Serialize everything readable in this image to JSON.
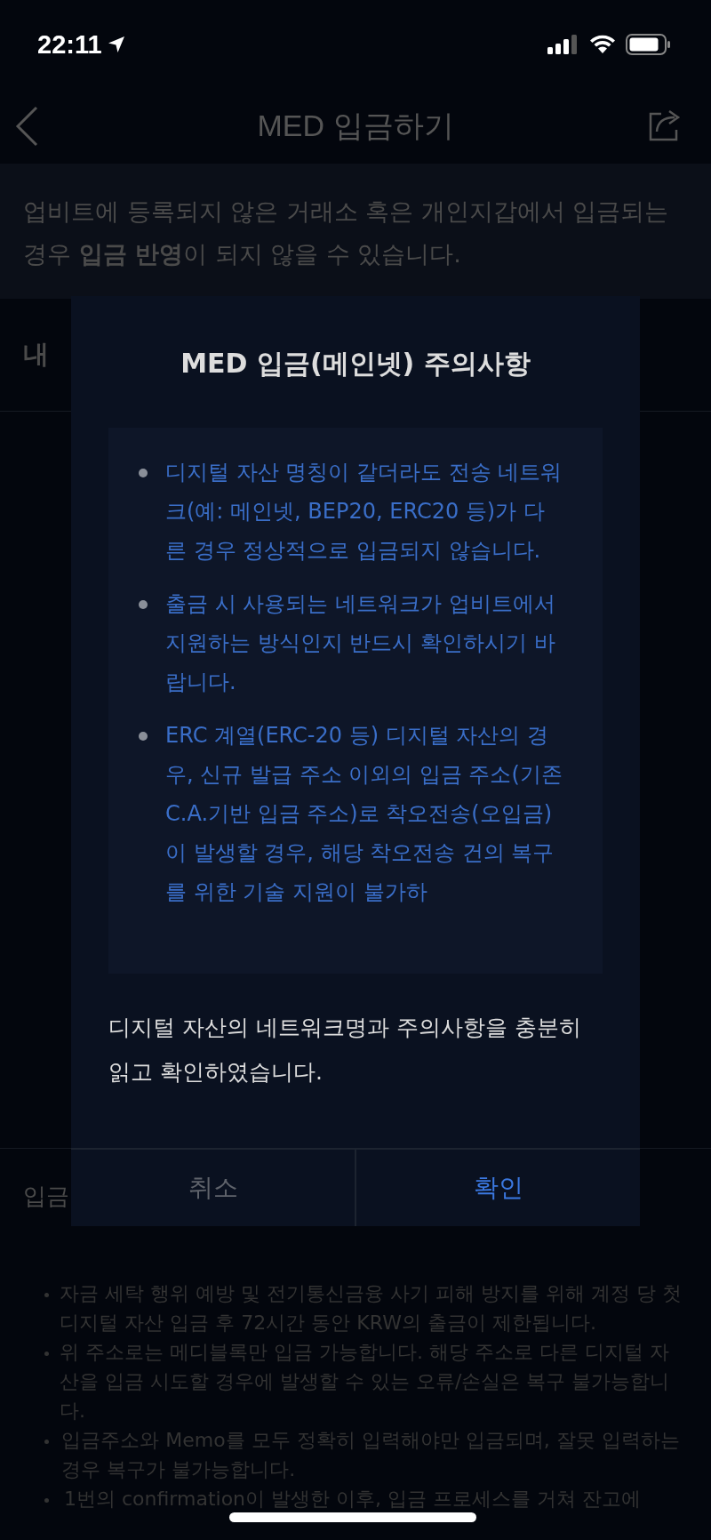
{
  "status_bar": {
    "time": "22:11"
  },
  "header": {
    "title": "MED 입금하기"
  },
  "banner": {
    "text": "업비트에 등록되지 않은 거래소 혹은 개인지갑에서 입금되는 경우 **입금 반영**이 되지 않을 수 있습니다."
  },
  "my_address": {
    "label": "내"
  },
  "deposit_notes": {
    "label": "입금",
    "items": [
      "자금 세탁 행위 예방 및 전기통신금융 사기 피해 방지를 위해 계정 당 첫 디지털 자산 입금 후 72시간 동안 KRW의 출금이 제한됩니다.",
      "위 주소로는 메디블록만 입금 가능합니다. 해당 주소로 다른 디지털 자산을 입금 시도할 경우에 발생할 수 있는 오류/손실은 복구 불가능합니다.",
      "입금주소와 Memo를 모두 정확히 입력해야만 입금되며, 잘못 입력하는 경우 복구가 불가능합니다.",
      "1번의 confirmation이 발생한 이후, 입금 프로세스를 거쳐 잔고에"
    ]
  },
  "dialog": {
    "title": "MED 입금(메인넷) 주의사항",
    "notices": [
      "디지털 자산 명칭이 같더라도 전송 네트워크(예: 메인넷, BEP20, ERC20 등)가 다른 경우 정상적으로 입금되지 않습니다.",
      "출금 시 사용되는 네트워크가 업비트에서 지원하는 방식인지 반드시 확인하시기 바랍니다.",
      "ERC 계열(ERC-20 등) 디지털 자산의 경우, 신규 발급 주소 이외의 입금 주소(기존 C.A.기반 입금 주소)로 착오전송(오입금)이 발생할 경우, 해당 착오전송 건의 복구를 위한 기술 지원이 불가하"
    ],
    "confirmation": "디지털 자산의 네트워크명과 주의사항을 충분히 읽고 확인하였습니다.",
    "buttons": [
      {
        "label": "취소",
        "kind": "cancel"
      },
      {
        "label": "확인",
        "kind": "confirm"
      }
    ]
  }
}
